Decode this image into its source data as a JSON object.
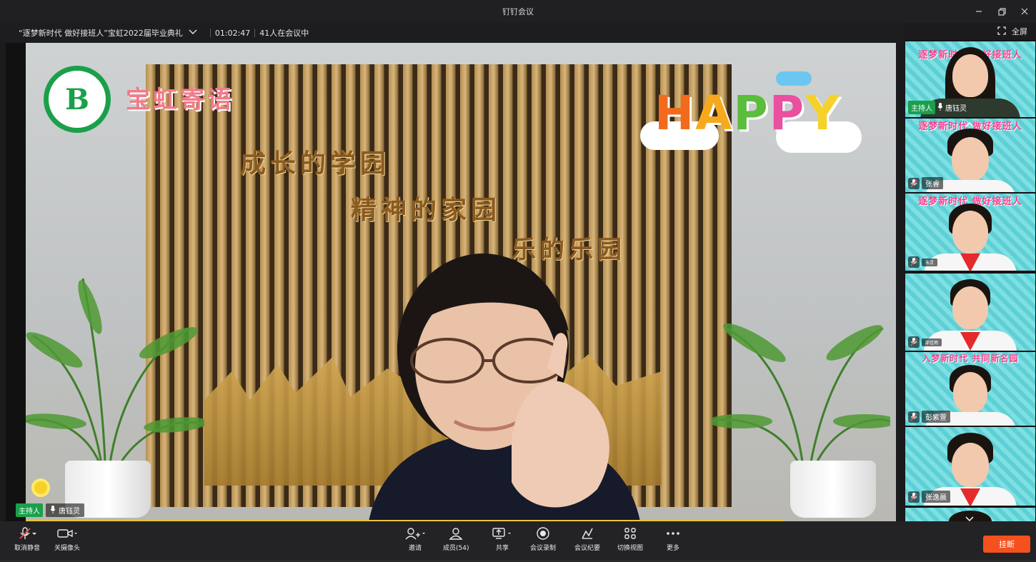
{
  "window": {
    "title": "钉钉会议",
    "minimize_icon": "minimize-icon",
    "restore_icon": "restore-icon",
    "close_icon": "close-icon"
  },
  "meeting": {
    "name": "“逐梦新时代 做好接班人”宝虹2022届毕业典礼",
    "duration": "01:02:47",
    "participants_status": "41人在会议中",
    "fullscreen_label": "全屏"
  },
  "main_video": {
    "host_badge": "主持人",
    "speaker_name": "唐钰灵"
  },
  "sidebar": {
    "tiles": [
      {
        "name": "唐钰灵",
        "host_badge": "主持人",
        "banner": "逐梦新时代 做好接班人"
      },
      {
        "name": "张睿",
        "banner": "逐梦新时代 做好接班人"
      },
      {
        "name": "朱灵",
        "banner": "逐梦新时代 做好接班人"
      },
      {
        "name": "邵佳雨",
        "banner": ""
      },
      {
        "name": "彭紫萱",
        "banner": "入梦新时代 共同新名园"
      },
      {
        "name": "张逸晨",
        "banner": ""
      },
      {
        "name": "",
        "banner": ""
      }
    ]
  },
  "toolbar": {
    "unmute_label": "取消静音",
    "camera_label": "关摄像头",
    "invite_label": "邀请",
    "members_label": "成员(54)",
    "share_label": "共享",
    "record_label": "会议录制",
    "minutes_label": "会议纪要",
    "switch_view_label": "切换视图",
    "more_label": "更多",
    "hangup_label": "挂断"
  },
  "colors": {
    "host_green": "#1aa04a",
    "hangup_orange": "#f4511e",
    "toolbar_bg": "#232326"
  }
}
